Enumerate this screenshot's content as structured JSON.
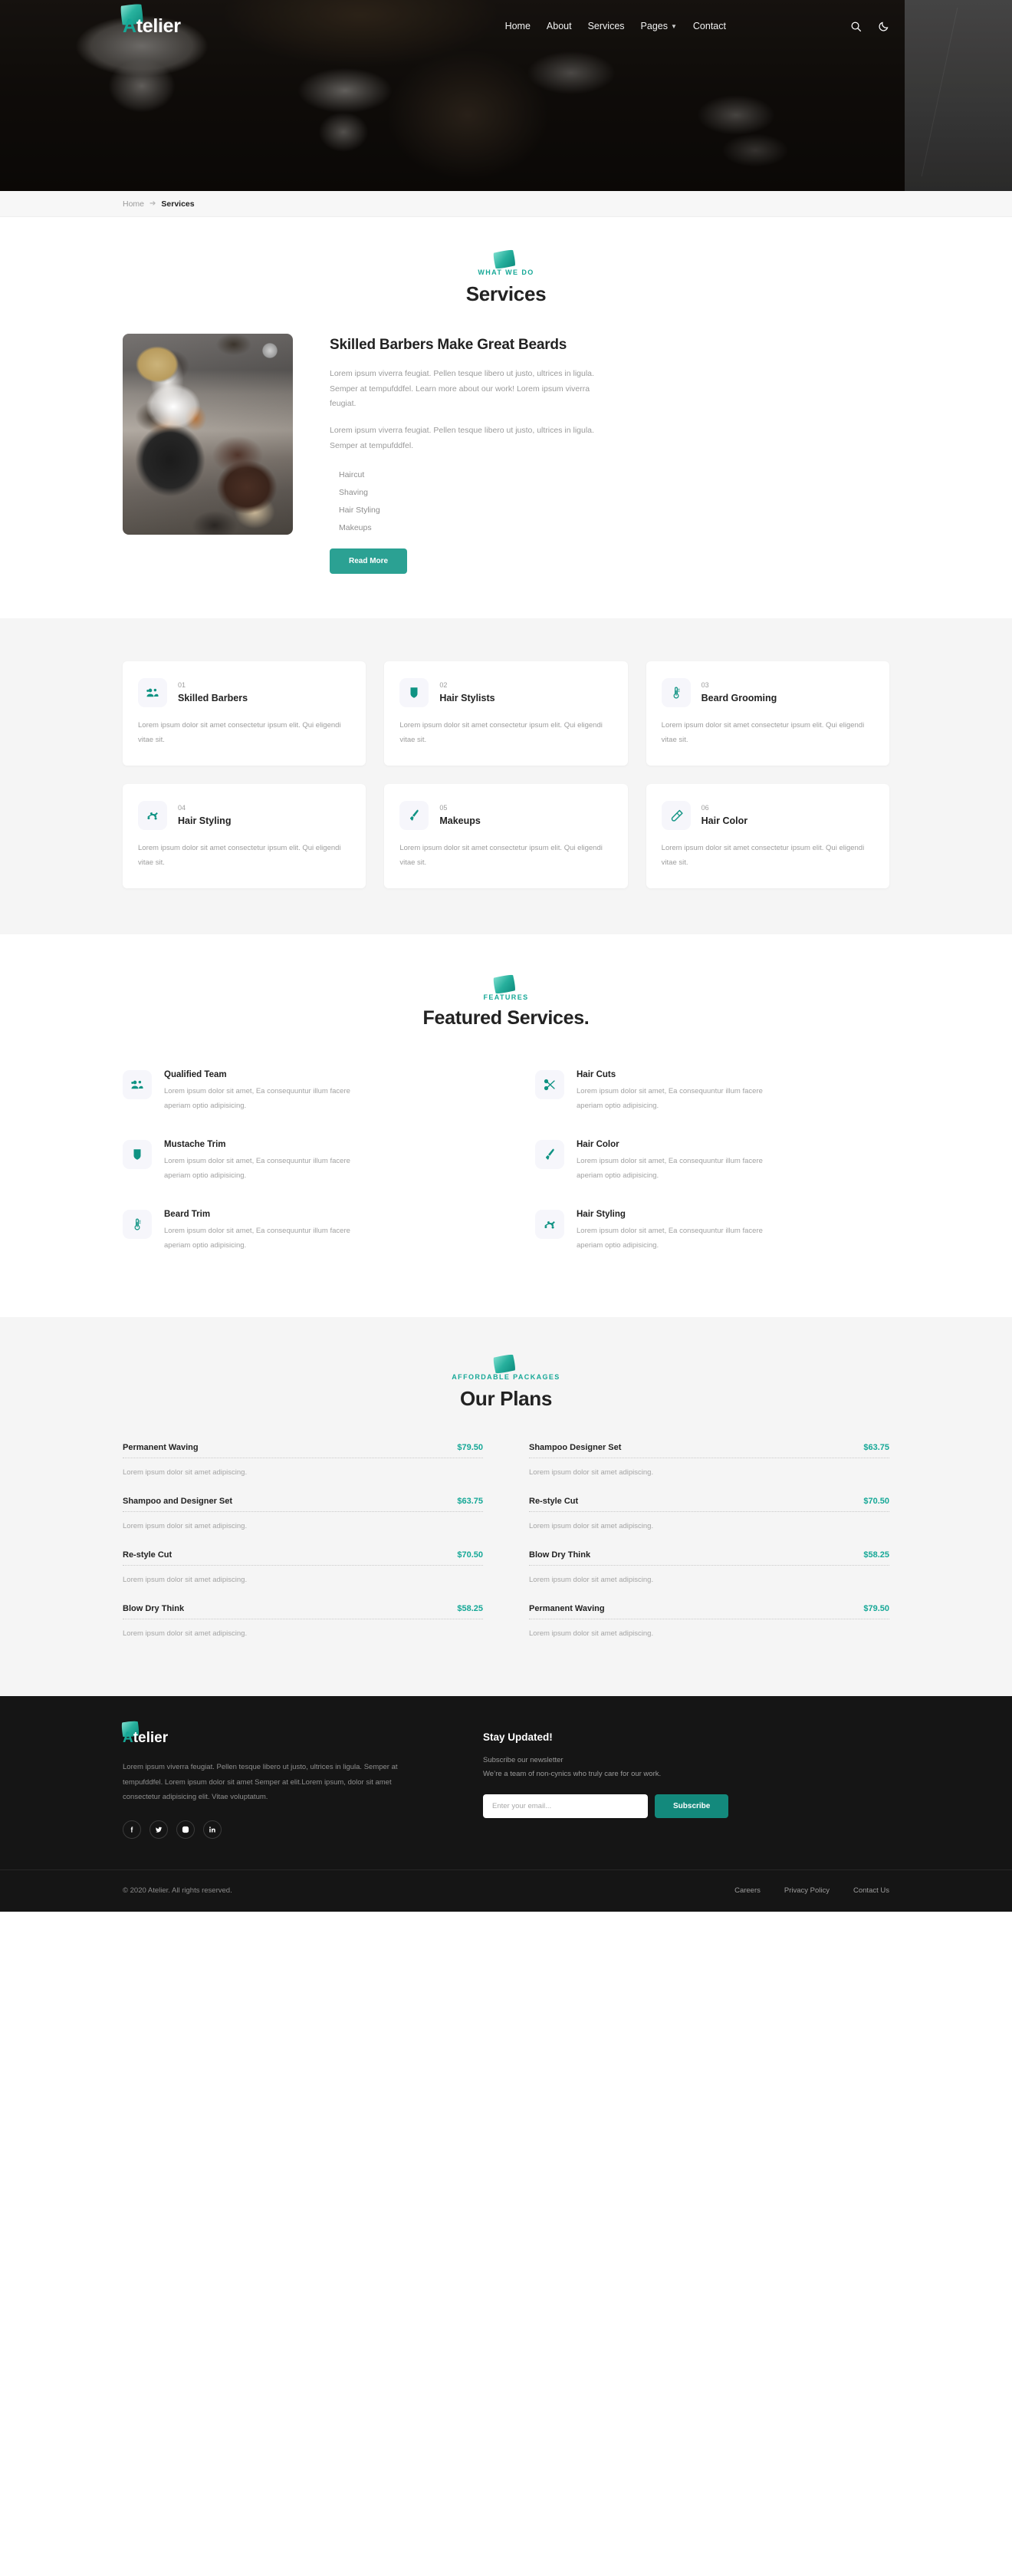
{
  "brand": {
    "first": "A",
    "rest": "telier"
  },
  "nav": {
    "links": [
      {
        "label": "Home",
        "caret": ""
      },
      {
        "label": "About",
        "caret": ""
      },
      {
        "label": "Services",
        "caret": ""
      },
      {
        "label": "Pages",
        "caret": "⌄"
      },
      {
        "label": "Contact",
        "caret": ""
      }
    ],
    "search_icon": "search-icon",
    "theme_icon": "moon-icon"
  },
  "breadcrumb": {
    "home": "Home",
    "arrow": "➔",
    "current": "Services"
  },
  "what_we_do": {
    "eyebrow": "WHAT WE DO",
    "title": "Services"
  },
  "about": {
    "heading": "Skilled Barbers Make Great Beards",
    "para1": "Lorem ipsum viverra feugiat. Pellen tesque libero ut justo, ultrices in ligula. Semper at tempufddfel. Learn more about our work! Lorem ipsum viverra feugiat.",
    "para2": "Lorem ipsum viverra feugiat. Pellen tesque libero ut justo, ultrices in ligula. Semper at tempufddfel.",
    "list": [
      "Haircut",
      "Shaving",
      "Hair Styling",
      "Makeups"
    ],
    "button": "Read More"
  },
  "cards": [
    {
      "num": "01",
      "title": "Skilled Barbers",
      "desc": "Lorem ipsum dolor sit amet consectetur ipsum elit. Qui eligendi vitae sit.",
      "icon": "users-icon"
    },
    {
      "num": "02",
      "title": "Hair Stylists",
      "desc": "Lorem ipsum dolor sit amet consectetur ipsum elit. Qui eligendi vitae sit.",
      "icon": "shield-icon"
    },
    {
      "num": "03",
      "title": "Beard Grooming",
      "desc": "Lorem ipsum dolor sit amet consectetur ipsum elit. Qui eligendi vitae sit.",
      "icon": "thermometer-icon"
    },
    {
      "num": "04",
      "title": "Hair Styling",
      "desc": "Lorem ipsum dolor sit amet consectetur ipsum elit. Qui eligendi vitae sit.",
      "icon": "hair-styling-icon"
    },
    {
      "num": "05",
      "title": "Makeups",
      "desc": "Lorem ipsum dolor sit amet consectetur ipsum elit. Qui eligendi vitae sit.",
      "icon": "brush-icon"
    },
    {
      "num": "06",
      "title": "Hair Color",
      "desc": "Lorem ipsum dolor sit amet consectetur ipsum elit. Qui eligendi vitae sit.",
      "icon": "comb-icon"
    }
  ],
  "features": {
    "eyebrow": "FEATURES",
    "title": "Featured Services.",
    "items": [
      {
        "title": "Qualified Team",
        "desc": "Lorem ipsum dolor sit amet, Ea consequuntur illum facere aperiam optio adipisicing.",
        "icon": "users-icon"
      },
      {
        "title": "Hair Cuts",
        "desc": "Lorem ipsum dolor sit amet, Ea consequuntur illum facere aperiam optio adipisicing.",
        "icon": "scissors-icon"
      },
      {
        "title": "Mustache Trim",
        "desc": "Lorem ipsum dolor sit amet, Ea consequuntur illum facere aperiam optio adipisicing.",
        "icon": "shield-icon"
      },
      {
        "title": "Hair Color",
        "desc": "Lorem ipsum dolor sit amet, Ea consequuntur illum facere aperiam optio adipisicing.",
        "icon": "brush-icon"
      },
      {
        "title": "Beard Trim",
        "desc": "Lorem ipsum dolor sit amet, Ea consequuntur illum facere aperiam optio adipisicing.",
        "icon": "thermometer-icon"
      },
      {
        "title": "Hair Styling",
        "desc": "Lorem ipsum dolor sit amet, Ea consequuntur illum facere aperiam optio adipisicing.",
        "icon": "hair-styling-icon"
      }
    ]
  },
  "plans": {
    "eyebrow": "AFFORDABLE PACKAGES",
    "title": "Our Plans",
    "left": [
      {
        "name": "Permanent Waving",
        "price": "$79.50",
        "desc": "Lorem ipsum dolor sit amet adipiscing."
      },
      {
        "name": "Shampoo and Designer Set",
        "price": "$63.75",
        "desc": "Lorem ipsum dolor sit amet adipiscing."
      },
      {
        "name": "Re-style Cut",
        "price": "$70.50",
        "desc": "Lorem ipsum dolor sit amet adipiscing."
      },
      {
        "name": "Blow Dry Think",
        "price": "$58.25",
        "desc": "Lorem ipsum dolor sit amet adipiscing."
      }
    ],
    "right": [
      {
        "name": "Shampoo Designer Set",
        "price": "$63.75",
        "desc": "Lorem ipsum dolor sit amet adipiscing."
      },
      {
        "name": "Re-style Cut",
        "price": "$70.50",
        "desc": "Lorem ipsum dolor sit amet adipiscing."
      },
      {
        "name": "Blow Dry Think",
        "price": "$58.25",
        "desc": "Lorem ipsum dolor sit amet adipiscing."
      },
      {
        "name": "Permanent Waving",
        "price": "$79.50",
        "desc": "Lorem ipsum dolor sit amet adipiscing."
      }
    ]
  },
  "footer": {
    "about": "Lorem ipsum viverra feugiat. Pellen tesque libero ut justo, ultrices in ligula. Semper at tempufddfel. Lorem ipsum dolor sit amet Semper at elit.Lorem ipsum, dolor sit amet consectetur adipisicing elit. Vitae voluptatum.",
    "socials": [
      "facebook-icon",
      "twitter-icon",
      "instagram-icon",
      "linkedin-icon"
    ],
    "newsletter": {
      "title": "Stay Updated!",
      "sub1": "Subscribe our newsletter",
      "sub2": "We’re a team of non-cynics who truly care for our work.",
      "placeholder": "Enter your email...",
      "value": "",
      "button": "Subscribe"
    },
    "copyright": "© 2020 Atelier. All rights reserved.",
    "links": [
      "Careers",
      "Privacy Policy",
      "Contact Us"
    ]
  },
  "colors": {
    "accent": "#16a897",
    "button": "#2ba193",
    "subscribe": "#13897c",
    "dark": "#151515"
  }
}
